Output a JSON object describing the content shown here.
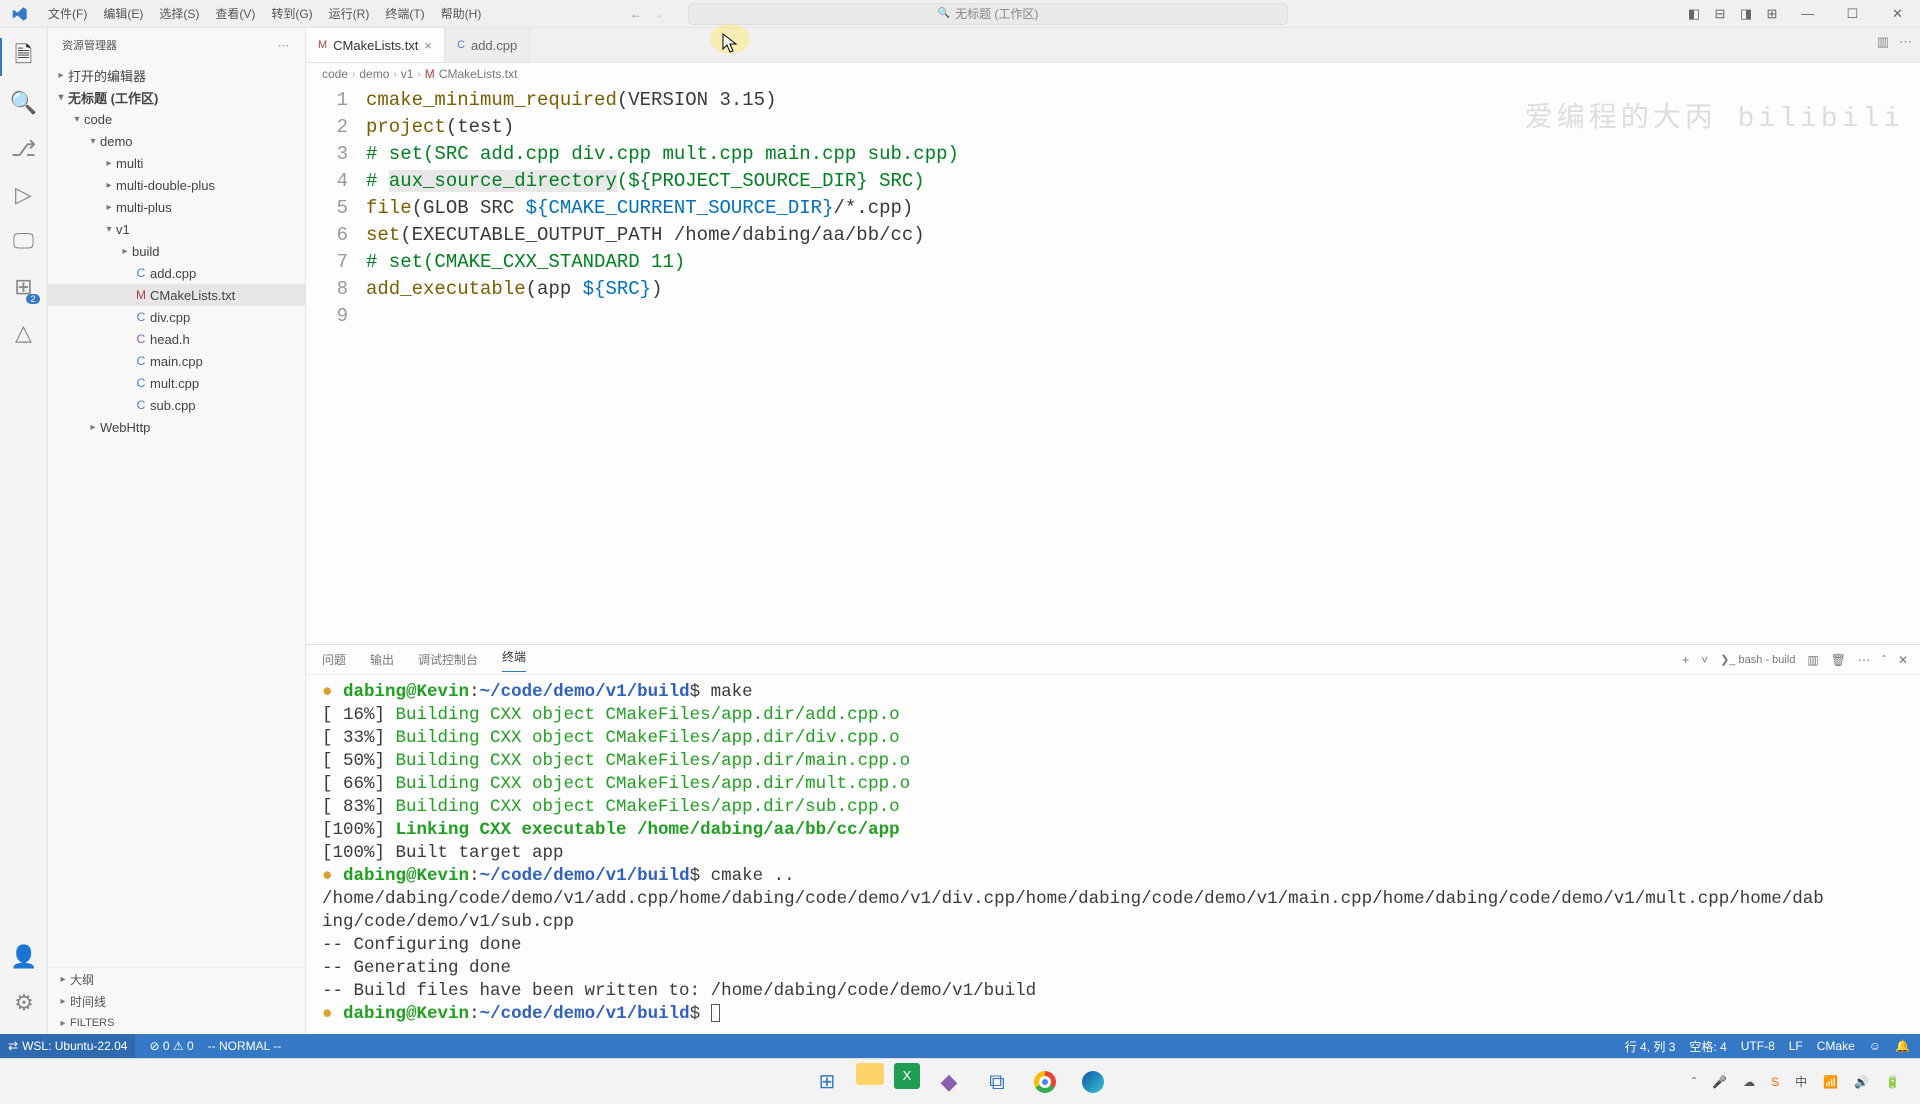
{
  "menu": {
    "items": [
      "文件(F)",
      "编辑(E)",
      "选择(S)",
      "查看(V)",
      "转到(G)",
      "运行(R)",
      "终端(T)",
      "帮助(H)"
    ]
  },
  "search_placeholder": "无标题 (工作区)",
  "sidebar": {
    "header": "资源管理器",
    "open_editors": "打开的编辑器",
    "workspace": "无标题 (工作区)",
    "tree": [
      {
        "indent": 1,
        "chev": "▾",
        "label": "code"
      },
      {
        "indent": 2,
        "chev": "▾",
        "label": "demo"
      },
      {
        "indent": 3,
        "chev": "▸",
        "label": "multi"
      },
      {
        "indent": 3,
        "chev": "▸",
        "label": "multi-double-plus"
      },
      {
        "indent": 3,
        "chev": "▸",
        "label": "multi-plus"
      },
      {
        "indent": 3,
        "chev": "▾",
        "label": "v1"
      },
      {
        "indent": 4,
        "chev": "▸",
        "label": "build"
      },
      {
        "indent": 4,
        "icon": "C",
        "iconColor": "#4d7fbf",
        "label": "add.cpp"
      },
      {
        "indent": 4,
        "icon": "M",
        "iconColor": "#b04040",
        "label": "CMakeLists.txt",
        "sel": true
      },
      {
        "indent": 4,
        "icon": "C",
        "iconColor": "#4d7fbf",
        "label": "div.cpp"
      },
      {
        "indent": 4,
        "icon": "C",
        "iconColor": "#8860b0",
        "label": "head.h"
      },
      {
        "indent": 4,
        "icon": "C",
        "iconColor": "#4d7fbf",
        "label": "main.cpp"
      },
      {
        "indent": 4,
        "icon": "C",
        "iconColor": "#4d7fbf",
        "label": "mult.cpp"
      },
      {
        "indent": 4,
        "icon": "C",
        "iconColor": "#4d7fbf",
        "label": "sub.cpp"
      },
      {
        "indent": 2,
        "chev": "▸",
        "label": "WebHttp"
      }
    ],
    "outline": "大纲",
    "timeline": "时间线",
    "filters": "FILTERS"
  },
  "tabs": [
    {
      "icon": "M",
      "iconColor": "#b04040",
      "label": "CMakeLists.txt",
      "active": true,
      "close": true
    },
    {
      "icon": "C",
      "iconColor": "#4d7fbf",
      "label": "add.cpp",
      "active": false,
      "close": false
    }
  ],
  "breadcrumb": [
    "code",
    "demo",
    "v1",
    "CMakeLists.txt"
  ],
  "breadcrumb_icon": "M",
  "code_lines": [
    {
      "n": 1,
      "html": "<span class='fn'>cmake_minimum_required</span>(VERSION 3.15)"
    },
    {
      "n": 2,
      "html": "<span class='fn'>project</span>(test)"
    },
    {
      "n": 3,
      "html": "<span class='cm'># set(SRC add.cpp div.cpp mult.cpp main.cpp sub.cpp)</span>"
    },
    {
      "n": 4,
      "html": "<span class='cm'># </span><span class='cm hl'>aux_source_directory</span><span class='cm'>(${PROJECT_SOURCE_DIR} SRC)</span>"
    },
    {
      "n": 5,
      "html": "<span class='fn'>file</span>(GLOB SRC <span class='var'>${CMAKE_CURRENT_SOURCE_DIR}</span>/*.cpp)"
    },
    {
      "n": 6,
      "html": "<span class='fn'>set</span>(EXECUTABLE_OUTPUT_PATH /home/dabing/aa/bb/cc)"
    },
    {
      "n": 7,
      "html": "<span class='cm'># set(CMAKE_CXX_STANDARD 11)</span>"
    },
    {
      "n": 8,
      "html": "<span class='fn'>add_executable</span>(app <span class='var'>${SRC}</span>)"
    },
    {
      "n": 9,
      "html": ""
    }
  ],
  "panel": {
    "tabs": [
      "问题",
      "输出",
      "调试控制台",
      "终端"
    ],
    "active": 3,
    "right_label": "bash - build",
    "lines": [
      {
        "html": "<span class='bullet'>●</span> <span class='prompt'>dabing@Kevin</span>:<span class='path'>~/code/demo/v1/build</span>$ make"
      },
      {
        "html": "[ 16%] <span class='build'>Building CXX object CMakeFiles/app.dir/add.cpp.o</span>"
      },
      {
        "html": "[ 33%] <span class='build'>Building CXX object CMakeFiles/app.dir/div.cpp.o</span>"
      },
      {
        "html": "[ 50%] <span class='build'>Building CXX object CMakeFiles/app.dir/main.cpp.o</span>"
      },
      {
        "html": "[ 66%] <span class='build'>Building CXX object CMakeFiles/app.dir/mult.cpp.o</span>"
      },
      {
        "html": "[ 83%] <span class='build'>Building CXX object CMakeFiles/app.dir/sub.cpp.o</span>"
      },
      {
        "html": "[100%] <span class='link'>Linking CXX executable /home/dabing/aa/bb/cc/app</span>"
      },
      {
        "html": "[100%] Built target app"
      },
      {
        "html": "<span class='bullet'>●</span> <span class='prompt'>dabing@Kevin</span>:<span class='path'>~/code/demo/v1/build</span>$ cmake .."
      },
      {
        "html": "/home/dabing/code/demo/v1/add.cpp/home/dabing/code/demo/v1/div.cpp/home/dabing/code/demo/v1/main.cpp/home/dabing/code/demo/v1/mult.cpp/home/dab"
      },
      {
        "html": "ing/code/demo/v1/sub.cpp"
      },
      {
        "html": "-- Configuring done"
      },
      {
        "html": "-- Generating done"
      },
      {
        "html": "-- Build files have been written to: /home/dabing/code/demo/v1/build"
      },
      {
        "html": "<span class='bullet'>●</span> <span class='prompt'>dabing@Kevin</span>:<span class='path'>~/code/demo/v1/build</span>$ <span class='cursor-box'></span>"
      }
    ]
  },
  "status": {
    "wsl": "WSL: Ubuntu-22.04",
    "errors": "⊘ 0 ⚠ 0",
    "mode": "-- NORMAL --",
    "pos": "行 4, 列 3",
    "spaces": "空格: 4",
    "enc": "UTF-8",
    "eol": "LF",
    "lang": "CMake",
    "bell": "🔔"
  }
}
